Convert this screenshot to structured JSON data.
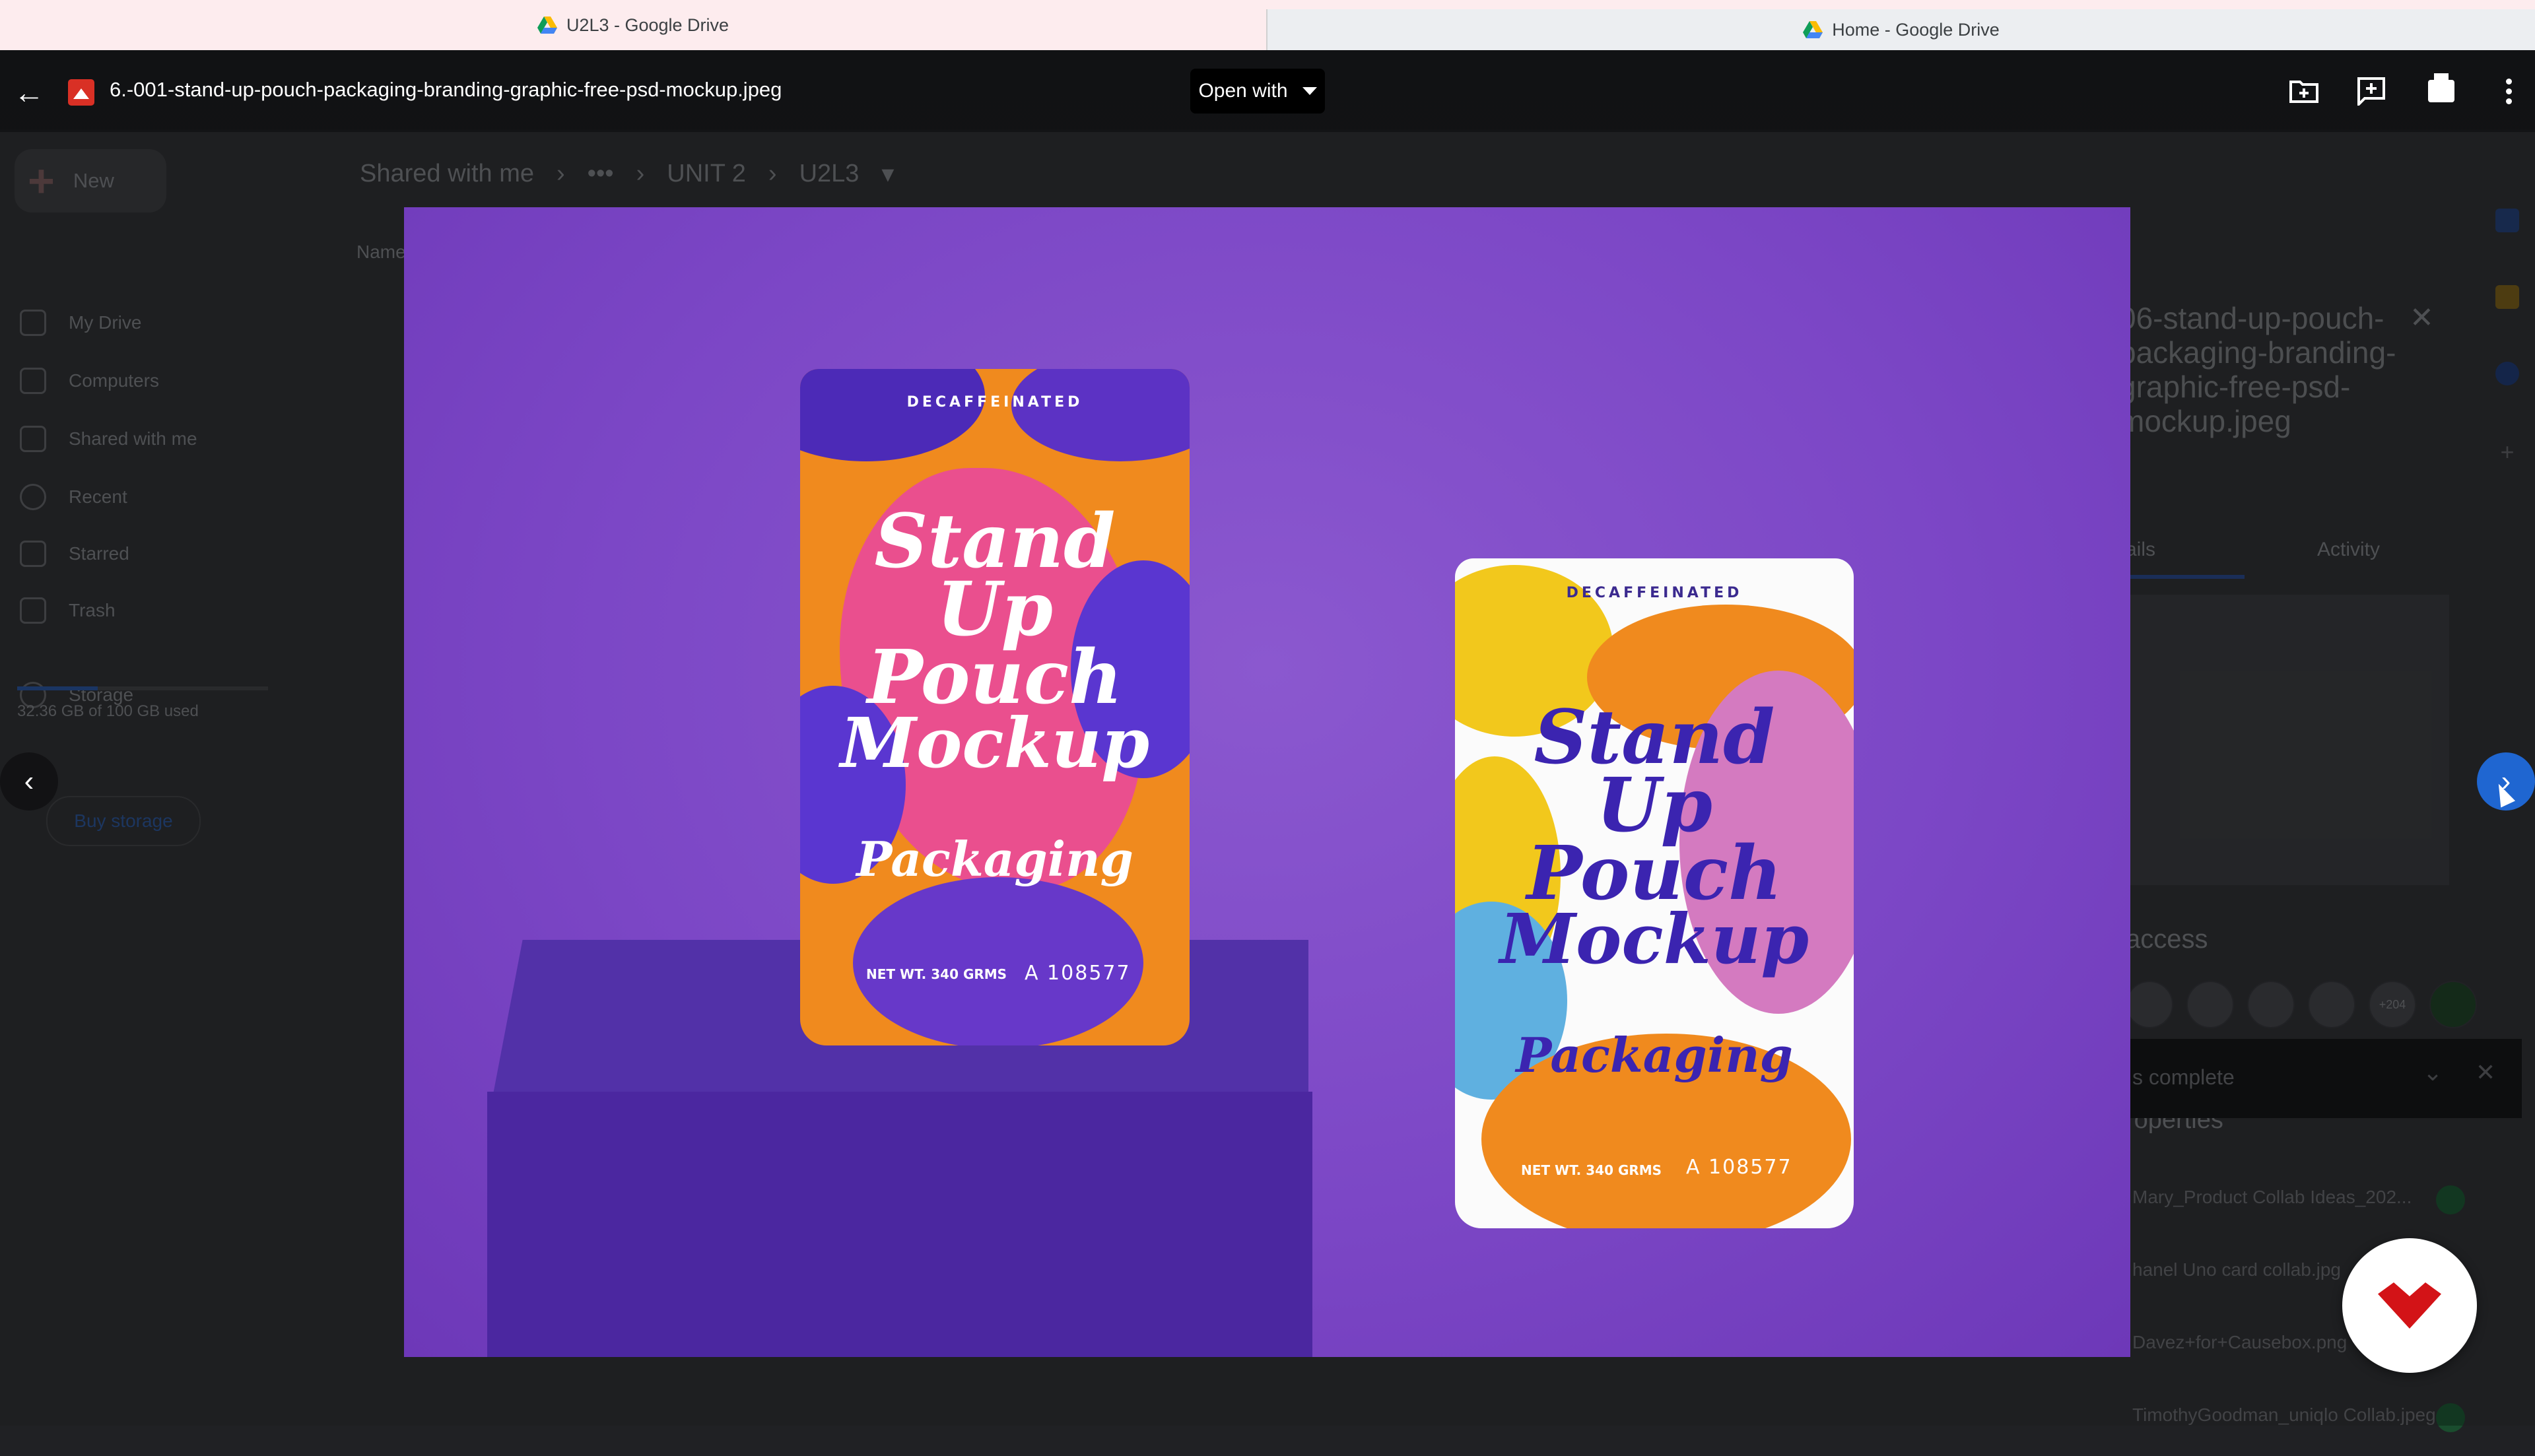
{
  "browser": {
    "tabs": [
      {
        "title": "U2L3 - Google Drive"
      },
      {
        "title": "Home - Google Drive"
      }
    ]
  },
  "drive_background": {
    "new_label": "New",
    "nav": [
      {
        "label": "My Drive"
      },
      {
        "label": "Computers"
      },
      {
        "label": "Shared with me"
      },
      {
        "label": "Recent"
      },
      {
        "label": "Starred"
      },
      {
        "label": "Trash"
      },
      {
        "label": "Storage"
      }
    ],
    "storage_used": "32.36 GB of 100 GB used",
    "storage_fraction": 0.32,
    "buy_storage": "Buy storage",
    "breadcrumb": [
      "Shared with me",
      "•••",
      "UNIT 2",
      "U2L3"
    ],
    "name_header": "Name",
    "details_panel": {
      "title_fragment": "06-stand-up-pouch-packaging-branding-graphic-free-psd-mockup.jpeg",
      "tab_details": "ails",
      "tab_activity": "Activity",
      "access_heading": "access",
      "avatar_more": "+204",
      "access_link": "ccess",
      "properties_heading": "roperties"
    },
    "uploads": {
      "status": "s complete",
      "items": [
        {
          "name": "Mary_Product Collab Ideas_202..."
        },
        {
          "name": "hanel Uno card collab.jpg"
        },
        {
          "name": "Davez+for+Causebox.png"
        },
        {
          "name": "TimothyGoodman_uniqlo Collab.jpeg"
        }
      ]
    }
  },
  "viewer": {
    "file_name": "6.-001-stand-up-pouch-packaging-branding-graphic-free-psd-mockup.jpeg",
    "open_with_label": "Open with",
    "toolbar_icons": [
      "help-icon",
      "add-to-drive-icon",
      "add-comment-icon",
      "print-icon",
      "more-options-icon"
    ],
    "prev_icon": "chevron-left-icon",
    "next_icon": "chevron-right-icon"
  },
  "image_content": {
    "pouch1": {
      "top_label": "DECAFFEINATED",
      "script_lines": [
        "Stand",
        "Up",
        "Pouch",
        "Mockup"
      ],
      "packaging": "Packaging",
      "net_weight": "NET WT. 340 GRMS",
      "code": "A 108577"
    },
    "pouch2": {
      "top_label": "DECAFFEINATED",
      "script_lines": [
        "Stand",
        "Up",
        "Pouch",
        "Mockup"
      ],
      "packaging": "Packaging",
      "net_weight": "NET WT. 340 GRMS",
      "code": "A 108577"
    }
  },
  "colors": {
    "image_background": "#7c47c6",
    "pedestal": "#4b27a0",
    "next_button": "#1f66d1",
    "file_icon": "#d93025"
  }
}
